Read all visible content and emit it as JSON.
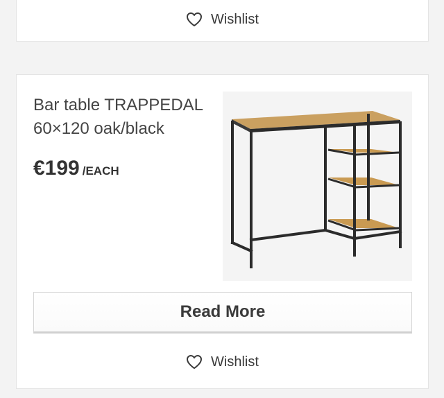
{
  "top_card": {
    "wishlist_label": "Wishlist",
    "wishlist_icon": "heart-outline-icon"
  },
  "product": {
    "title_line1": "Bar table TRAPPEDAL",
    "title_line2": "60×120 oak/black",
    "price": "€199",
    "unit": "/EACH",
    "image_alt": "bar-table-trappedal-image",
    "read_more_label": "Read More",
    "wishlist_label": "Wishlist",
    "wishlist_icon": "heart-outline-icon"
  },
  "colors": {
    "page_background": "#f3f3f3",
    "card_background": "#ffffff",
    "text": "#333333",
    "wood": "#c99a52",
    "frame": "#2b2b2b"
  }
}
